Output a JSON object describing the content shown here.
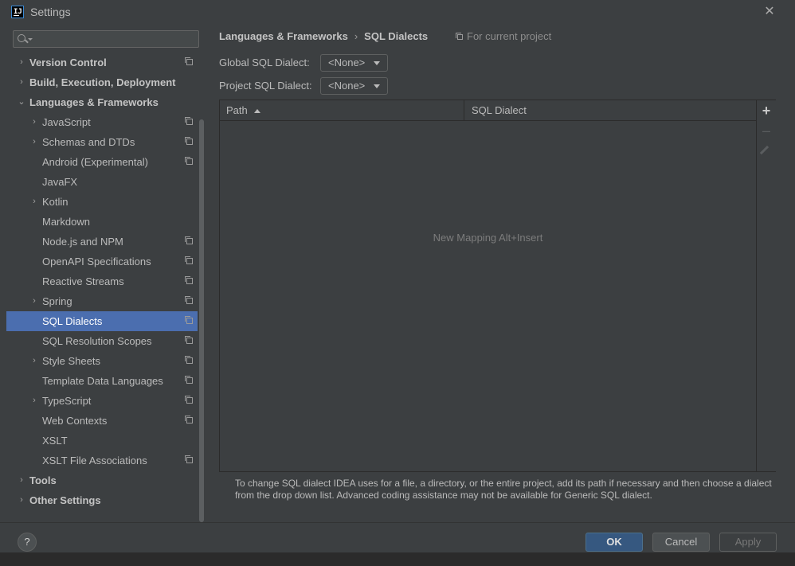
{
  "window": {
    "title": "Settings"
  },
  "search": {
    "placeholder": ""
  },
  "sidebar": {
    "items": [
      {
        "label": "Version Control",
        "level": 0,
        "arrow": "›",
        "bold": true,
        "project_icon": true
      },
      {
        "label": "Build, Execution, Deployment",
        "level": 0,
        "arrow": "›",
        "bold": true,
        "project_icon": false
      },
      {
        "label": "Languages & Frameworks",
        "level": 0,
        "arrow": "⌄",
        "bold": true,
        "project_icon": false
      },
      {
        "label": "JavaScript",
        "level": 1,
        "arrow": "›",
        "bold": false,
        "project_icon": true
      },
      {
        "label": "Schemas and DTDs",
        "level": 1,
        "arrow": "›",
        "bold": false,
        "project_icon": true
      },
      {
        "label": "Android (Experimental)",
        "level": 1,
        "arrow": "",
        "bold": false,
        "project_icon": true
      },
      {
        "label": "JavaFX",
        "level": 1,
        "arrow": "",
        "bold": false,
        "project_icon": false
      },
      {
        "label": "Kotlin",
        "level": 1,
        "arrow": "›",
        "bold": false,
        "project_icon": false
      },
      {
        "label": "Markdown",
        "level": 1,
        "arrow": "",
        "bold": false,
        "project_icon": false
      },
      {
        "label": "Node.js and NPM",
        "level": 1,
        "arrow": "",
        "bold": false,
        "project_icon": true
      },
      {
        "label": "OpenAPI Specifications",
        "level": 1,
        "arrow": "",
        "bold": false,
        "project_icon": true
      },
      {
        "label": "Reactive Streams",
        "level": 1,
        "arrow": "",
        "bold": false,
        "project_icon": true
      },
      {
        "label": "Spring",
        "level": 1,
        "arrow": "›",
        "bold": false,
        "project_icon": true
      },
      {
        "label": "SQL Dialects",
        "level": 1,
        "arrow": "",
        "bold": false,
        "project_icon": true,
        "selected": true
      },
      {
        "label": "SQL Resolution Scopes",
        "level": 1,
        "arrow": "",
        "bold": false,
        "project_icon": true
      },
      {
        "label": "Style Sheets",
        "level": 1,
        "arrow": "›",
        "bold": false,
        "project_icon": true
      },
      {
        "label": "Template Data Languages",
        "level": 1,
        "arrow": "",
        "bold": false,
        "project_icon": true
      },
      {
        "label": "TypeScript",
        "level": 1,
        "arrow": "›",
        "bold": false,
        "project_icon": true
      },
      {
        "label": "Web Contexts",
        "level": 1,
        "arrow": "",
        "bold": false,
        "project_icon": true
      },
      {
        "label": "XSLT",
        "level": 1,
        "arrow": "",
        "bold": false,
        "project_icon": false
      },
      {
        "label": "XSLT File Associations",
        "level": 1,
        "arrow": "",
        "bold": false,
        "project_icon": true
      },
      {
        "label": "Tools",
        "level": 0,
        "arrow": "›",
        "bold": true,
        "project_icon": false
      },
      {
        "label": "Other Settings",
        "level": 0,
        "arrow": "›",
        "bold": true,
        "project_icon": false
      }
    ]
  },
  "main": {
    "breadcrumb": [
      "Languages & Frameworks",
      "SQL Dialects"
    ],
    "breadcrumb_sep": "›",
    "scope_note": "For current project",
    "global_label": "Global SQL Dialect:",
    "global_value": "<None>",
    "project_label": "Project SQL Dialect:",
    "project_value": "<None>",
    "table": {
      "columns": [
        "Path",
        "SQL Dialect"
      ],
      "empty_text": "New Mapping Alt+Insert"
    },
    "hint": "To change SQL dialect IDEA uses for a file, a directory, or the entire project, add its path if necessary and then choose a dialect from the drop down list. Advanced coding assistance may not be available for Generic SQL dialect."
  },
  "footer": {
    "help": "?",
    "ok": "OK",
    "cancel": "Cancel",
    "apply": "Apply"
  },
  "colors": {
    "selection": "#4b6eaf",
    "ok_button": "#365880",
    "panel": "#3c3f41"
  }
}
